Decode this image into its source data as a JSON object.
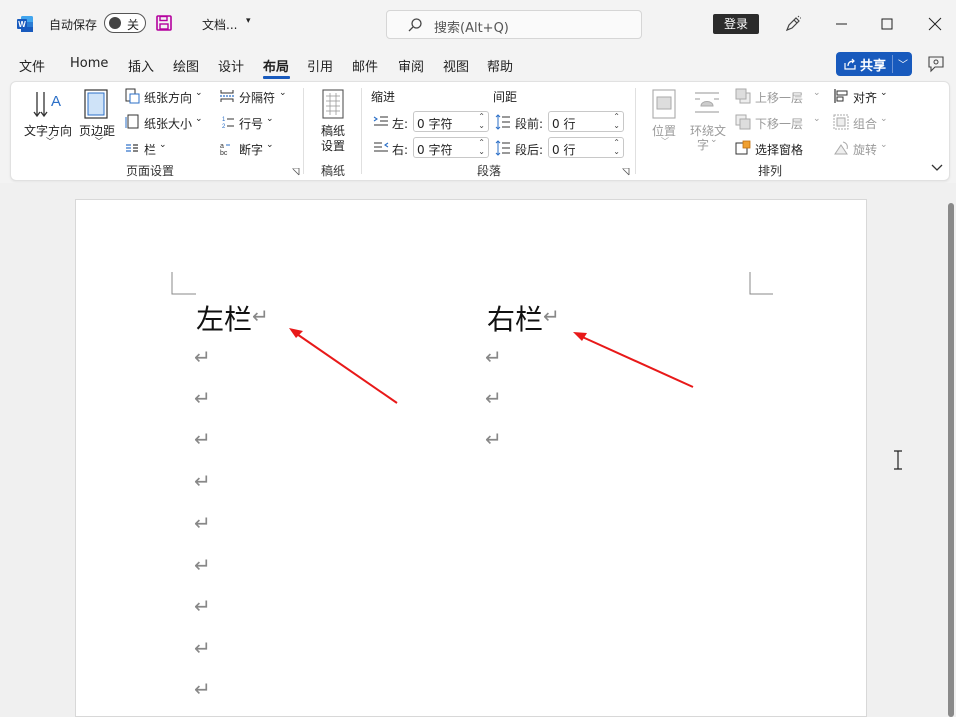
{
  "titlebar": {
    "autosave_label": "自动保存",
    "autosave_state": "关",
    "doc_title": "文档...",
    "search_placeholder": "搜索(Alt+Q)",
    "login_label": "登录"
  },
  "menu": {
    "items": [
      "文件",
      "Home",
      "插入",
      "绘图",
      "设计",
      "布局",
      "引用",
      "邮件",
      "审阅",
      "视图",
      "帮助"
    ],
    "active": "布局",
    "share_label": "共享"
  },
  "ribbon": {
    "page_setup": {
      "text_direction": "文字方向",
      "margins": "页边距",
      "orientation": "纸张方向",
      "size": "纸张大小",
      "columns": "栏",
      "breaks": "分隔符",
      "line_numbers": "行号",
      "hyphenation": "断字",
      "group_label": "页面设置"
    },
    "manuscript": {
      "line1": "稿纸",
      "line2": "设置",
      "group_label": "稿纸"
    },
    "paragraph": {
      "indent_header": "缩进",
      "spacing_header": "间距",
      "left_label": "左:",
      "right_label": "右:",
      "before_label": "段前:",
      "after_label": "段后:",
      "left_value": "0 字符",
      "right_value": "0 字符",
      "before_value": "0 行",
      "after_value": "0 行",
      "group_label": "段落"
    },
    "arrange": {
      "position": "位置",
      "wrap_line1": "环绕文",
      "wrap_line2": "字",
      "bring_forward": "上移一层",
      "send_backward": "下移一层",
      "selection_pane": "选择窗格",
      "align": "对齐",
      "group": "组合",
      "rotate": "旋转",
      "group_label": "排列"
    }
  },
  "document": {
    "left_column_text": "左栏",
    "right_column_text": "右栏",
    "paragraph_mark": "↵"
  },
  "colors": {
    "accent": "#185abd",
    "arrow": "#e81919"
  }
}
